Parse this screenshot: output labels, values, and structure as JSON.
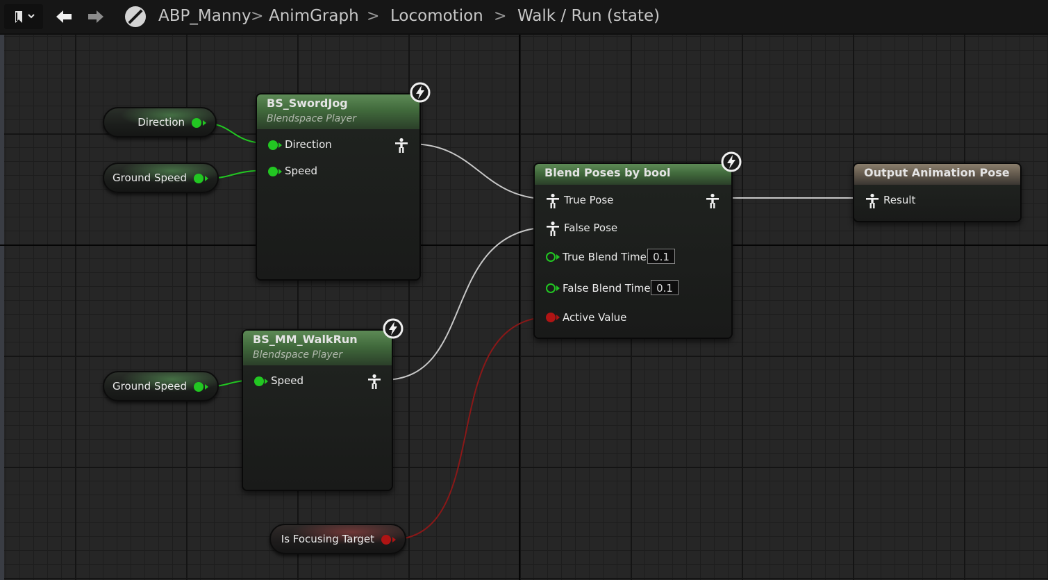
{
  "breadcrumb": {
    "items": [
      "ABP_Manny",
      "AnimGraph",
      "Locomotion",
      "Walk / Run (state)"
    ],
    "separator": ">"
  },
  "toolbar": {
    "bookmark_icon": "bookmark-icon",
    "back_icon": "arrow-left-icon",
    "forward_icon": "arrow-right-icon",
    "graph_icon": "animgraph-icon"
  },
  "variables": {
    "direction": "Direction",
    "ground_speed_top": "Ground Speed",
    "ground_speed_bottom": "Ground Speed",
    "is_focusing_target": "Is Focusing Target"
  },
  "nodes": {
    "sword_jog": {
      "title": "BS_SwordJog",
      "subtitle": "Blendspace Player",
      "inputs": [
        "Direction",
        "Speed"
      ]
    },
    "walk_run": {
      "title": "BS_MM_WalkRun",
      "subtitle": "Blendspace Player",
      "inputs": [
        "Speed"
      ]
    },
    "blend_poses": {
      "title": "Blend Poses by bool",
      "true_pose": "True Pose",
      "false_pose": "False Pose",
      "true_blend_time_label": "True Blend Time",
      "true_blend_time_value": "0.1",
      "false_blend_time_label": "False Blend Time",
      "false_blend_time_value": "0.1",
      "active_value": "Active Value"
    },
    "output_pose": {
      "title": "Output Animation Pose",
      "result": "Result"
    }
  },
  "colors": {
    "float_pin": "#22c722",
    "bool_pin": "#b01414",
    "pose_wire": "#c8c8c8",
    "node_header_green": "#416a3c",
    "node_header_output": "#675d50"
  }
}
